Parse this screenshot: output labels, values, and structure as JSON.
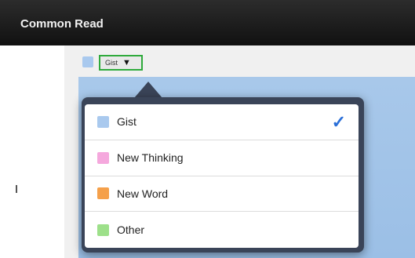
{
  "app": {
    "title": "Common Read"
  },
  "tag_selector": {
    "selected": "Gist",
    "arrow": "▼",
    "swatch_color": "#a9c9ee"
  },
  "menu": {
    "items": [
      {
        "label": "Gist",
        "color": "#a9c9ee",
        "checked": true
      },
      {
        "label": "New Thinking",
        "color": "#f5a8dd"
      },
      {
        "label": "New Word",
        "color": "#f5a04a"
      },
      {
        "label": "Other",
        "color": "#9de08a"
      }
    ],
    "check_mark": "✓"
  }
}
